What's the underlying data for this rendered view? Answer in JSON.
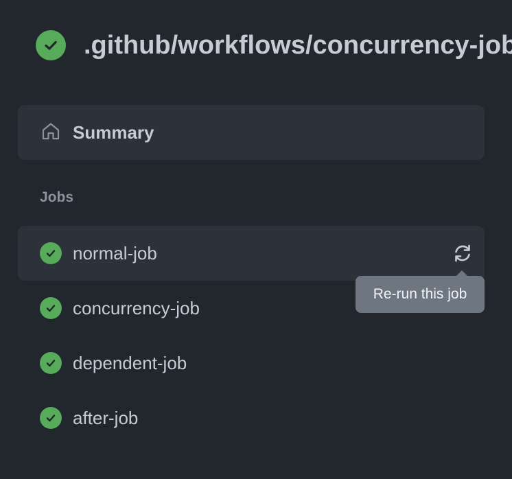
{
  "workflow": {
    "title": ".github/workflows/concurrency-job.yml",
    "status": "success"
  },
  "summary": {
    "label": "Summary",
    "icon": "home-icon"
  },
  "jobs": {
    "heading": "Jobs",
    "items": [
      {
        "label": "normal-job",
        "status": "success",
        "selected": true
      },
      {
        "label": "concurrency-job",
        "status": "success",
        "selected": false
      },
      {
        "label": "dependent-job",
        "status": "success",
        "selected": false
      },
      {
        "label": "after-job",
        "status": "success",
        "selected": false
      }
    ]
  },
  "rerun": {
    "icon": "sync-icon",
    "tooltip": "Re-run this job"
  },
  "colors": {
    "background": "#22262d",
    "panel": "#2d3139",
    "success": "#57ab5a",
    "tooltip": "#6e7681"
  }
}
